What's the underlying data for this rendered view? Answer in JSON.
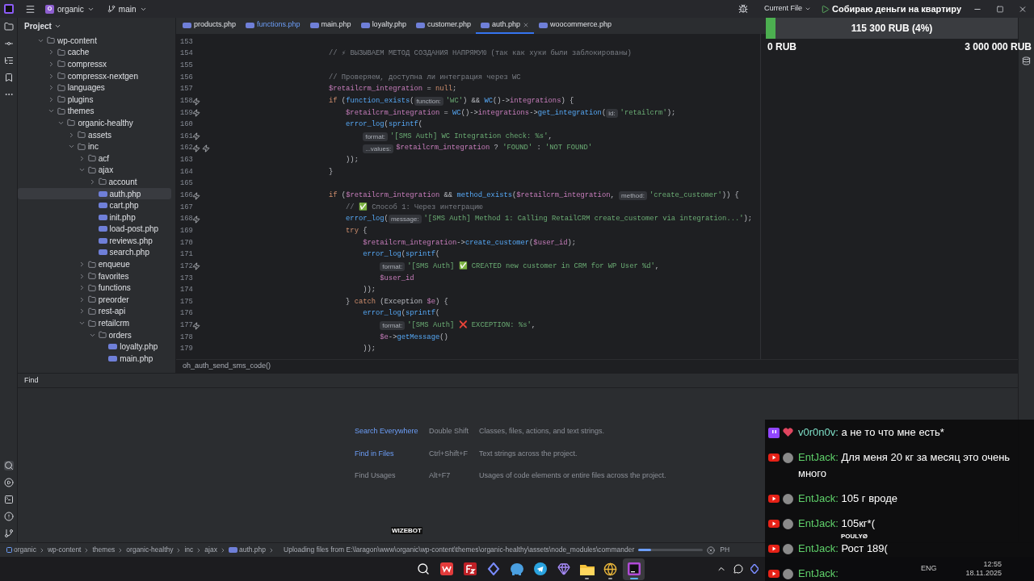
{
  "top_bar": {
    "project_badge": "O",
    "project": "organic",
    "branch": "main",
    "run_config": "Current File"
  },
  "donation": {
    "title": "Собираю деньги на квартиру",
    "amount": "115 300 RUB (4%)",
    "level": 0.04,
    "min": "0 RUB",
    "max": "3 000 000 RUB"
  },
  "project": {
    "title": "Project",
    "tree": [
      {
        "label": "wp-content",
        "kind": "folder",
        "expanded": true,
        "selected": false,
        "children": [
          {
            "label": "cache",
            "kind": "folder",
            "expanded": false,
            "selected": false
          },
          {
            "label": "compressx",
            "kind": "folder",
            "expanded": false,
            "selected": false
          },
          {
            "label": "compressx-nextgen",
            "kind": "folder",
            "expanded": false,
            "selected": false
          },
          {
            "label": "languages",
            "kind": "folder",
            "expanded": false,
            "selected": false
          },
          {
            "label": "plugins",
            "kind": "folder",
            "expanded": false,
            "selected": false
          },
          {
            "label": "themes",
            "kind": "folder",
            "expanded": true,
            "selected": false,
            "children": [
              {
                "label": "organic-healthy",
                "kind": "folder",
                "expanded": true,
                "selected": false,
                "children": [
                  {
                    "label": "assets",
                    "kind": "folder",
                    "expanded": false,
                    "selected": false
                  },
                  {
                    "label": "inc",
                    "kind": "folder",
                    "expanded": true,
                    "selected": false,
                    "children": [
                      {
                        "label": "acf",
                        "kind": "folder",
                        "expanded": false,
                        "selected": false
                      },
                      {
                        "label": "ajax",
                        "kind": "folder",
                        "expanded": true,
                        "selected": false,
                        "children": [
                          {
                            "label": "account",
                            "kind": "folder",
                            "expanded": false,
                            "selected": false
                          },
                          {
                            "label": "auth.php",
                            "kind": "php",
                            "selected": true
                          },
                          {
                            "label": "cart.php",
                            "kind": "php",
                            "selected": false
                          },
                          {
                            "label": "init.php",
                            "kind": "php",
                            "selected": false
                          },
                          {
                            "label": "load-post.php",
                            "kind": "php",
                            "selected": false
                          },
                          {
                            "label": "reviews.php",
                            "kind": "php",
                            "selected": false
                          },
                          {
                            "label": "search.php",
                            "kind": "php",
                            "selected": false
                          }
                        ]
                      },
                      {
                        "label": "enqueue",
                        "kind": "folder",
                        "expanded": false,
                        "selected": false
                      },
                      {
                        "label": "favorites",
                        "kind": "folder",
                        "expanded": false,
                        "selected": false
                      },
                      {
                        "label": "functions",
                        "kind": "folder",
                        "expanded": false,
                        "selected": false
                      },
                      {
                        "label": "preorder",
                        "kind": "folder",
                        "expanded": false,
                        "selected": false
                      },
                      {
                        "label": "rest-api",
                        "kind": "folder",
                        "expanded": false,
                        "selected": false
                      },
                      {
                        "label": "retailcrm",
                        "kind": "folder",
                        "expanded": true,
                        "selected": false,
                        "children": [
                          {
                            "label": "orders",
                            "kind": "folder",
                            "expanded": true,
                            "selected": false,
                            "children": [
                              {
                                "label": "loyalty.php",
                                "kind": "php",
                                "selected": false
                              },
                              {
                                "label": "main.php",
                                "kind": "php",
                                "selected": false
                              }
                            ]
                          }
                        ]
                      }
                    ]
                  }
                ]
              }
            ]
          }
        ]
      }
    ]
  },
  "tabs": [
    {
      "label": "products.php",
      "selected": false,
      "modified": false
    },
    {
      "label": "functions.php",
      "selected": false,
      "modified": true
    },
    {
      "label": "main.php",
      "selected": false,
      "modified": false
    },
    {
      "label": "loyalty.php",
      "selected": false,
      "modified": false
    },
    {
      "label": "customer.php",
      "selected": false,
      "modified": false
    },
    {
      "label": "auth.php",
      "selected": true,
      "modified": false
    },
    {
      "label": "woocommerce.php",
      "selected": false,
      "modified": false
    }
  ],
  "code": [
    {
      "n": "153"
    },
    {
      "n": "154",
      "parts": [
        {
          "kind": "code",
          "text": "// ⚡ ВЫЗЫВАЕМ МЕТОД СОЗДАНИЯ НАПРЯМУЮ (так как хуки были заблокированы)"
        }
      ]
    },
    {
      "n": "155"
    },
    {
      "n": "156",
      "parts": [
        {
          "kind": "code",
          "text": "// Проверяем, доступна ли интеграция через WC"
        }
      ]
    },
    {
      "n": "157",
      "parts": [
        {
          "kind": "code",
          "text": "$retailcrm_integration = null;"
        }
      ]
    },
    {
      "n": "158",
      "markers": [
        {
          "kind": "override"
        }
      ],
      "parts": [
        {
          "kind": "code",
          "text": "if (function_exists("
        },
        {
          "kind": "hint",
          "text": "function:"
        },
        {
          "kind": "code",
          "text": "'WC') && WC()->integrations) {"
        }
      ],
      "children": [
        {
          "n": "159",
          "markers": [
            {
              "kind": "override"
            }
          ],
          "parts": [
            {
              "kind": "code",
              "text": "$retailcrm_integration = WC()->integrations->get_integration("
            },
            {
              "kind": "hint",
              "text": "id:"
            },
            {
              "kind": "code",
              "text": "'retailcrm');"
            }
          ]
        },
        {
          "n": "160",
          "parts": [
            {
              "kind": "code",
              "text": "error_log(sprintf("
            }
          ],
          "children": [
            {
              "n": "161",
              "markers": [
                {
                  "kind": "override"
                }
              ],
              "parts": [
                {
                  "kind": "hint",
                  "text": "format:"
                },
                {
                  "kind": "code",
                  "text": "'[SMS Auth] WC Integration check: %s',"
                }
              ]
            },
            {
              "n": "162",
              "markers": [
                {
                  "kind": "override"
                },
                {
                  "kind": "override"
                }
              ],
              "parts": [
                {
                  "kind": "hint",
                  "text": "...values:"
                },
                {
                  "kind": "code",
                  "text": "$retailcrm_integration ? 'FOUND' : 'NOT FOUND'"
                }
              ]
            }
          ]
        },
        {
          "n": "163",
          "parts": [
            {
              "kind": "code",
              "text": "));"
            }
          ]
        }
      ]
    },
    {
      "n": "164",
      "parts": [
        {
          "kind": "code",
          "text": "}"
        }
      ]
    },
    {
      "n": "165"
    },
    {
      "n": "166",
      "markers": [
        {
          "kind": "override"
        }
      ],
      "parts": [
        {
          "kind": "code",
          "text": "if ($retailcrm_integration && method_exists($retailcrm_integration, "
        },
        {
          "kind": "hint",
          "text": "method:"
        },
        {
          "kind": "code",
          "text": "'create_customer')) {"
        }
      ],
      "children": [
        {
          "n": "167",
          "parts": [
            {
              "kind": "code",
              "text": "// ✅ Способ 1: Через интеграцию"
            }
          ]
        },
        {
          "n": "168",
          "markers": [
            {
              "kind": "override"
            }
          ],
          "parts": [
            {
              "kind": "code",
              "text": "error_log("
            },
            {
              "kind": "hint",
              "text": "message:"
            },
            {
              "kind": "code",
              "text": "'[SMS Auth] Method 1: Calling RetailCRM create_customer via integration...');"
            }
          ]
        },
        {
          "n": "169",
          "parts": [
            {
              "kind": "code",
              "text": "try {"
            }
          ],
          "children": [
            {
              "n": "170",
              "parts": [
                {
                  "kind": "code",
                  "text": "$retailcrm_integration->create_customer($user_id);"
                }
              ]
            },
            {
              "n": "171",
              "parts": [
                {
                  "kind": "code",
                  "text": "error_log(sprintf("
                }
              ],
              "children": [
                {
                  "n": "172",
                  "markers": [
                    {
                      "kind": "override"
                    }
                  ],
                  "parts": [
                    {
                      "kind": "hint",
                      "text": "format:"
                    },
                    {
                      "kind": "code",
                      "text": "'[SMS Auth] ✅ CREATED new customer in CRM for WP User %d',"
                    }
                  ]
                },
                {
                  "n": "173",
                  "parts": [
                    {
                      "kind": "code",
                      "text": "$user_id"
                    }
                  ]
                }
              ]
            },
            {
              "n": "174",
              "parts": [
                {
                  "kind": "code",
                  "text": "));"
                }
              ]
            }
          ]
        },
        {
          "n": "175",
          "parts": [
            {
              "kind": "code",
              "text": "} catch (Exception $e) {"
            }
          ],
          "children": [
            {
              "n": "176",
              "parts": [
                {
                  "kind": "code",
                  "text": "error_log(sprintf("
                }
              ],
              "children": [
                {
                  "n": "177",
                  "markers": [
                    {
                      "kind": "override"
                    }
                  ],
                  "parts": [
                    {
                      "kind": "hint",
                      "text": "format:"
                    },
                    {
                      "kind": "code",
                      "text": "'[SMS Auth] ❌ EXCEPTION: %s',"
                    }
                  ]
                },
                {
                  "n": "178",
                  "parts": [
                    {
                      "kind": "code",
                      "text": "$e->getMessage()"
                    }
                  ]
                }
              ]
            },
            {
              "n": "179",
              "parts": [
                {
                  "kind": "code",
                  "text": "));"
                }
              ]
            }
          ]
        }
      ]
    }
  ],
  "editor_breadcrumb": "oh_auth_send_sms_code()",
  "find": {
    "title": "Find",
    "rows": [
      {
        "label": "Search Everywhere",
        "shortcut": "Double Shift",
        "description": "Classes, files, actions, and text strings.",
        "disabled": false
      },
      {
        "label": "Find in Files",
        "shortcut": "Ctrl+Shift+F",
        "description": "Text strings across the project.",
        "disabled": false
      },
      {
        "label": "Find Usages",
        "shortcut": "Alt+F7",
        "description": "Usages of code elements or entire files across the project.",
        "disabled": true
      }
    ]
  },
  "status_bar": {
    "breadcrumbs": [
      {
        "label": "organic",
        "kind": "project"
      },
      {
        "label": "wp-content"
      },
      {
        "label": "themes"
      },
      {
        "label": "organic-healthy"
      },
      {
        "label": "inc"
      },
      {
        "label": "ajax"
      },
      {
        "label": "auth.php",
        "kind": "php"
      }
    ],
    "task": "Uploading files from E:\\laragon\\www\\organic\\wp-content\\themes\\organic-healthy\\assets\\node_modules\\commander",
    "level": 0.2,
    "language": "PH"
  },
  "taskbar": {
    "apps": [
      {
        "kind": "search",
        "running": false,
        "selected": false
      },
      {
        "kind": "office",
        "running": false,
        "selected": false
      },
      {
        "kind": "ftp",
        "running": false,
        "selected": false
      },
      {
        "kind": "diamond",
        "running": false,
        "selected": false
      },
      {
        "kind": "elephant",
        "running": false,
        "selected": false
      },
      {
        "kind": "telegram",
        "running": false,
        "selected": false
      },
      {
        "kind": "crystal",
        "running": false,
        "selected": false
      },
      {
        "kind": "explorer",
        "running": true,
        "selected": false
      },
      {
        "kind": "browser",
        "running": true,
        "selected": false
      },
      {
        "kind": "ide",
        "running": true,
        "selected": true
      }
    ],
    "language": "ENG",
    "time": "12:55",
    "date": "18.11.2025"
  },
  "overlay_labels": [
    "WIZEBOT",
    "POULYØ"
  ],
  "chat": {
    "messages": [
      {
        "kind": "twitch",
        "user": "v0r0n0v:",
        "color": "#7fe0c8",
        "text": "а не то что мне есть*"
      },
      {
        "kind": "youtube",
        "user": "EntJack:",
        "color": "#5fd16a",
        "text": "Для меня 20 кг за месяц это очень много"
      },
      {
        "kind": "youtube",
        "user": "EntJack:",
        "color": "#5fd16a",
        "text": "105 г вроде"
      },
      {
        "kind": "youtube",
        "user": "EntJack:",
        "color": "#5fd16a",
        "text": "105кг*("
      },
      {
        "kind": "youtube",
        "user": "EntJack:",
        "color": "#5fd16a",
        "text": "Рост 189("
      },
      {
        "kind": "youtube",
        "user": "EntJack:",
        "color": "#5fd16a"
      }
    ]
  }
}
